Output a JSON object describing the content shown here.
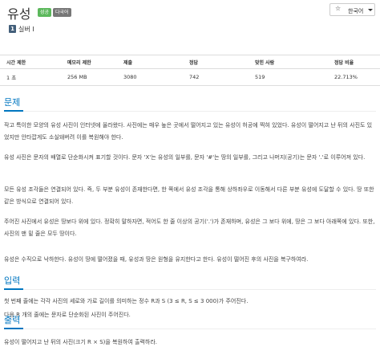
{
  "header": {
    "title": "유성",
    "badges": {
      "success": "성공",
      "multilang": "다국어"
    },
    "language": {
      "star": "☆",
      "label": "한국어"
    }
  },
  "tier": {
    "icon_text": "1",
    "label": "실버 I"
  },
  "info_table": {
    "headers": [
      "시간 제한",
      "메모리 제한",
      "제출",
      "정답",
      "맞힌 사람",
      "정답 비율"
    ],
    "row": [
      "1 초",
      "256 MB",
      "3080",
      "742",
      "519",
      "22.713%"
    ]
  },
  "sections": {
    "problem": {
      "title": "문제",
      "paragraphs": [
        "작고 특이한 모양의 유성 사진이 인터넷에 올라왔다. 사진에는 매우 높은 곳에서 떨어지고 있는 유성이 허공에 찍혀 있었다. 유성이 떨어지고 난 뒤의 사진도 있었지만 안타깝게도 소실돼버려 이를 복원해야 한다.",
        "유성 사진은 문자의 배열로 단순화시켜 표기할 것이다. 문자 'X'는 유성의 일부를, 문자 '#'는 땅의 일부를, 그리고 나머지(공기)는 문자 '.'로 이루어져 있다.",
        "모든 유성 조각들은 연결되어 있다. 즉, 두 부분 유성이 존재한다면, 한 쪽에서 유성 조각을 통해 상하좌우로 이동해서 다른 부분 유성에 도달할 수 있다. 땅 또한 같은 방식으로 연결되어 있다.",
        "주어진 사진에서 유성은 땅보다 위에 있다. 정확히 말하자면, 적어도 한 줄 이상의 공기('.')가 존재하며, 유성은 그 보다 위에, 땅은 그 보다 아래쪽에 있다. 또한, 사진의 맨 밑 줄은 모두 땅이다.",
        "유성은 수직으로 낙하한다. 유성이 땅에 떨어졌을 때, 유성과 땅은 원형을 유지한다고 한다. 유성이 떨어진 후의 사진을 복구하여라."
      ]
    },
    "input": {
      "title": "입력",
      "paragraphs": [
        "첫 번째 줄에는 각각 사진의 세로와 가로 길이를 의미하는 정수 R과 S (3 ≤ R, S ≤ 3 000)가 주어진다.",
        "다음 R 개의 줄에는 문자로 단순화된 사진이 주어진다."
      ]
    },
    "output": {
      "title": "출력",
      "paragraphs": [
        "유성이 떨어지고 난 뒤의 사진(크기 R × S)을 복원하여 출력하라."
      ]
    }
  },
  "colors": {
    "accent": "#0076c0",
    "success": "#5cb85c",
    "multilang": "#777777",
    "tier": "#435f7a"
  }
}
